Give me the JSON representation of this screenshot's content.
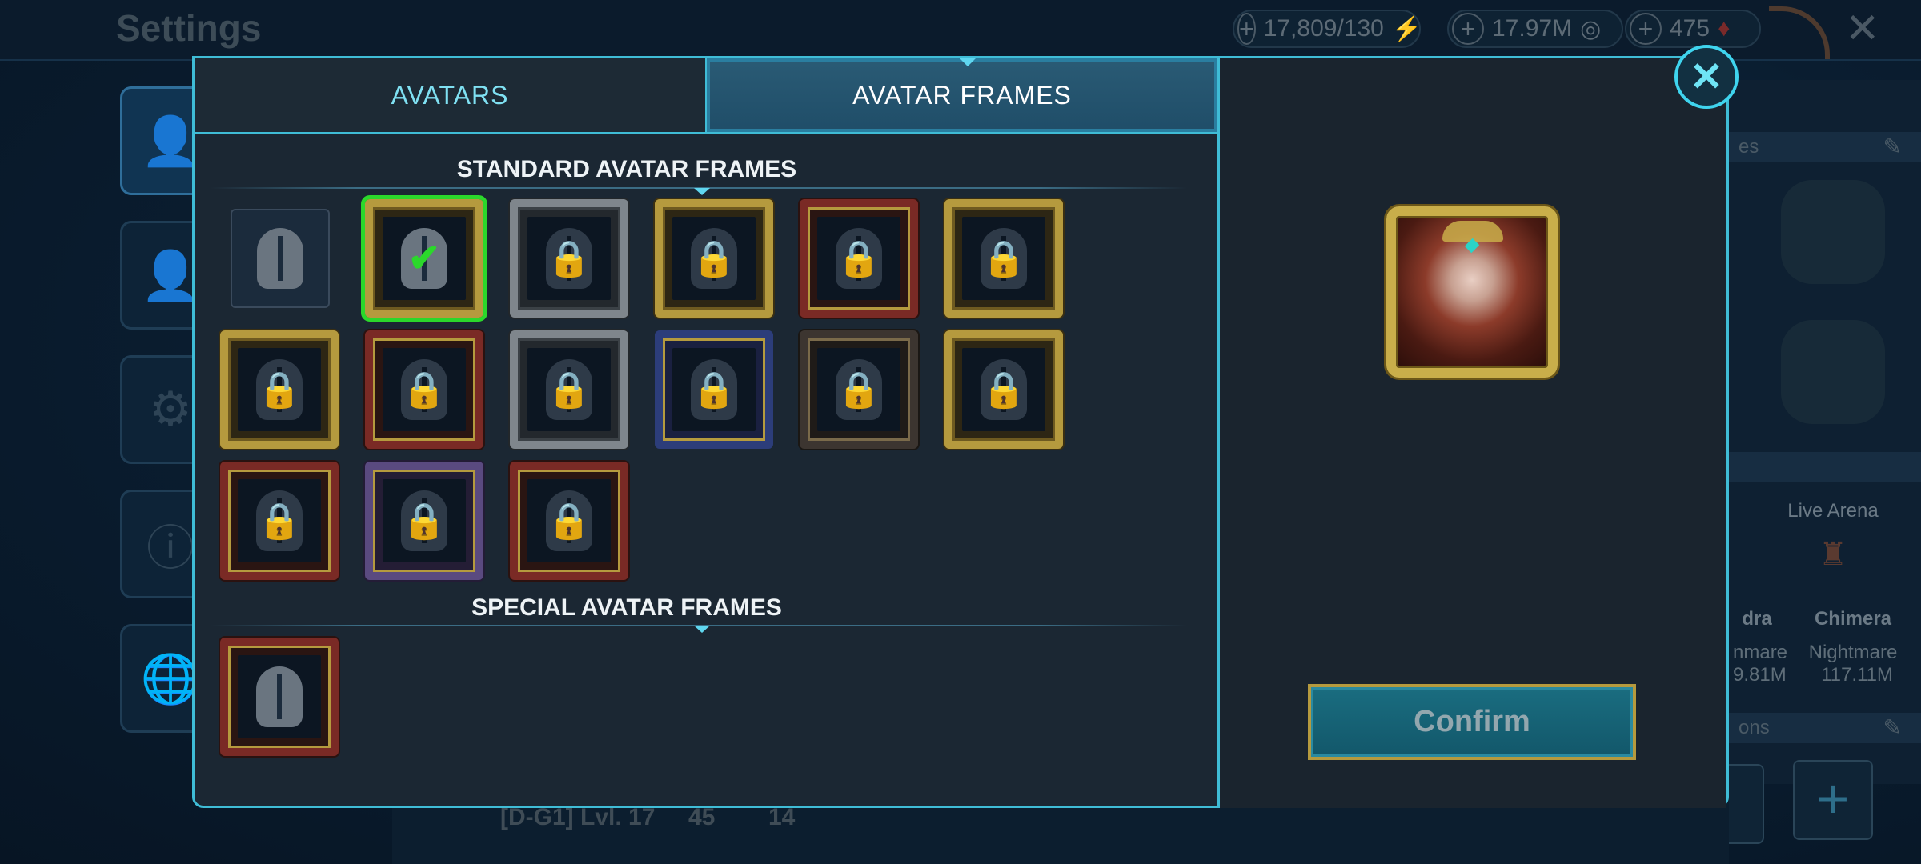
{
  "background": {
    "title": "Settings",
    "resources": [
      {
        "value": "17,809/130",
        "icon": "⚡",
        "color": "#5a7a2a"
      },
      {
        "value": "17.97M",
        "icon": "◎",
        "color": "#6b7a86"
      },
      {
        "value": "475",
        "icon": "♦",
        "color": "#7a2a2a"
      }
    ],
    "close_glyph": "✕",
    "side_icons": [
      "👤",
      "👤",
      "⚙",
      "ⓘ",
      "🌐"
    ],
    "right_panel": {
      "edit_glyph": "✎",
      "live_arena": "Live Arena",
      "col1_name": "dra",
      "col1_difficulty": "nmare",
      "col1_damage": "9.81M",
      "col2_name": "Chimera",
      "col2_difficulty": "Nightmare",
      "col2_damage": "117.11M",
      "bar1_text": "es",
      "bar2_text": "ons",
      "plus_glyph": "+"
    },
    "bottom": {
      "clan": "[D-G1] Lvl. 17",
      "count1": "45",
      "count2": "14"
    }
  },
  "modal": {
    "tabs": [
      {
        "label": "AVATARS",
        "active": false
      },
      {
        "label": "AVATAR FRAMES",
        "active": true
      }
    ],
    "standard_title": "STANDARD AVATAR FRAMES",
    "special_title": "SPECIAL AVATAR FRAMES",
    "lock_glyph": "🔒",
    "check_glyph": "✔",
    "close_glyph": "✕",
    "confirm_label": "Confirm"
  }
}
